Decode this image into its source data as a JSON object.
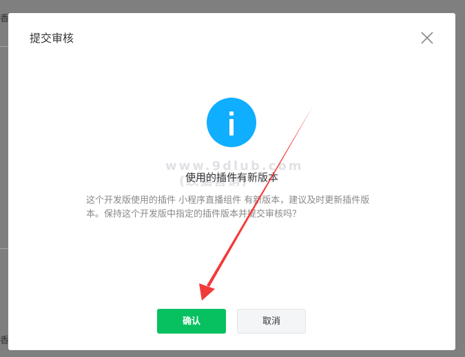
{
  "background": {
    "edge_text_top": "香",
    "edge_text_bottom": "香"
  },
  "modal": {
    "title": "提交审核",
    "close_icon": "close-icon",
    "info_icon": "info-icon",
    "info_symbol": "i",
    "subtitle": "使用的插件有新版本",
    "description": "这个开发版使用的插件 小程序直播组件 有新版本，建议及时更新插件版本。保持这个开发版中指定的插件版本并提交审核吗？",
    "confirm_label": "确认",
    "cancel_label": "取消"
  },
  "watermark": {
    "line1": "www.9dlub.com",
    "line2": "(纹猫营销)"
  },
  "colors": {
    "accent_green": "#07c160",
    "info_blue": "#10aeff",
    "annotation_red": "#f23a3a"
  }
}
